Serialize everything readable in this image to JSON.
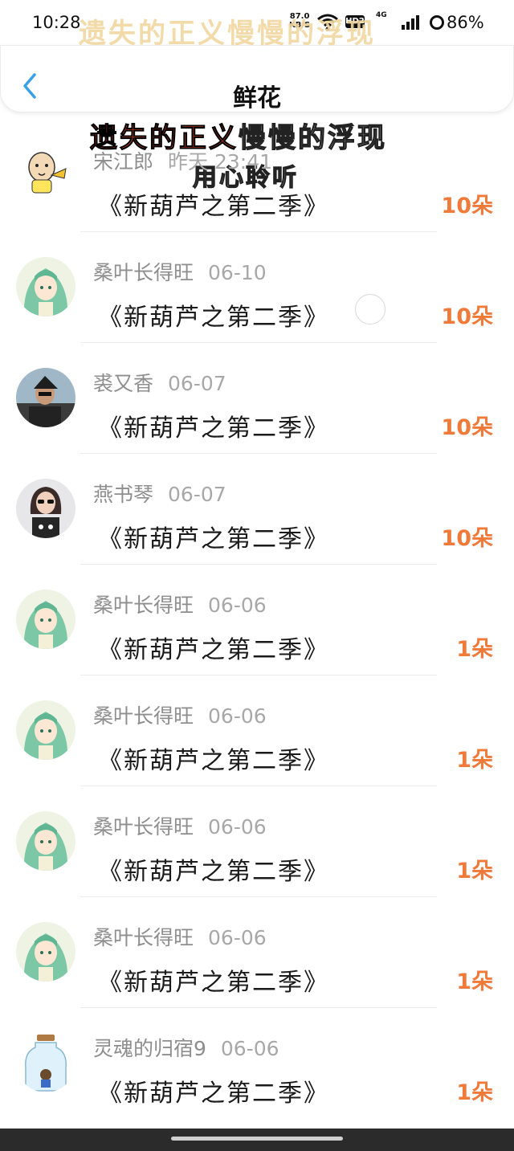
{
  "status_bar": {
    "time": "10:28",
    "net_speed": "87.0",
    "net_unit": "KB/S",
    "hd_badge": "HD2",
    "network": "4G",
    "battery": "86%"
  },
  "header": {
    "title": "鲜花"
  },
  "overlay": {
    "line1": "遗失的正义慢慢的浮现",
    "line2_red": "遗失的正义",
    "line2_white": "慢慢的浮现",
    "line3": "用心聆听"
  },
  "colors": {
    "accent_blue": "#3aa0e8",
    "count_orange": "#f07a3a"
  },
  "items": [
    {
      "user": "宋江郎",
      "time": "昨天 23:41",
      "title": "《新葫芦之第二季》",
      "count": "10朵",
      "avatar": "cartoon-avatar"
    },
    {
      "user": "桑叶长得旺",
      "time": "06-10",
      "title": "《新葫芦之第二季》",
      "count": "10朵",
      "avatar": "anime-girl-avatar"
    },
    {
      "user": "裘又香",
      "time": "06-07",
      "title": "《新葫芦之第二季》",
      "count": "10朵",
      "avatar": "man-photo-avatar"
    },
    {
      "user": "燕书琴",
      "time": "06-07",
      "title": "《新葫芦之第二季》",
      "count": "10朵",
      "avatar": "woman-photo-avatar"
    },
    {
      "user": "桑叶长得旺",
      "time": "06-06",
      "title": "《新葫芦之第二季》",
      "count": "1朵",
      "avatar": "anime-girl-avatar"
    },
    {
      "user": "桑叶长得旺",
      "time": "06-06",
      "title": "《新葫芦之第二季》",
      "count": "1朵",
      "avatar": "anime-girl-avatar"
    },
    {
      "user": "桑叶长得旺",
      "time": "06-06",
      "title": "《新葫芦之第二季》",
      "count": "1朵",
      "avatar": "anime-girl-avatar"
    },
    {
      "user": "桑叶长得旺",
      "time": "06-06",
      "title": "《新葫芦之第二季》",
      "count": "1朵",
      "avatar": "anime-girl-avatar"
    },
    {
      "user": "灵魂的归宿9",
      "time": "06-06",
      "title": "《新葫芦之第二季》",
      "count": "1朵",
      "avatar": "bottle-avatar"
    }
  ]
}
